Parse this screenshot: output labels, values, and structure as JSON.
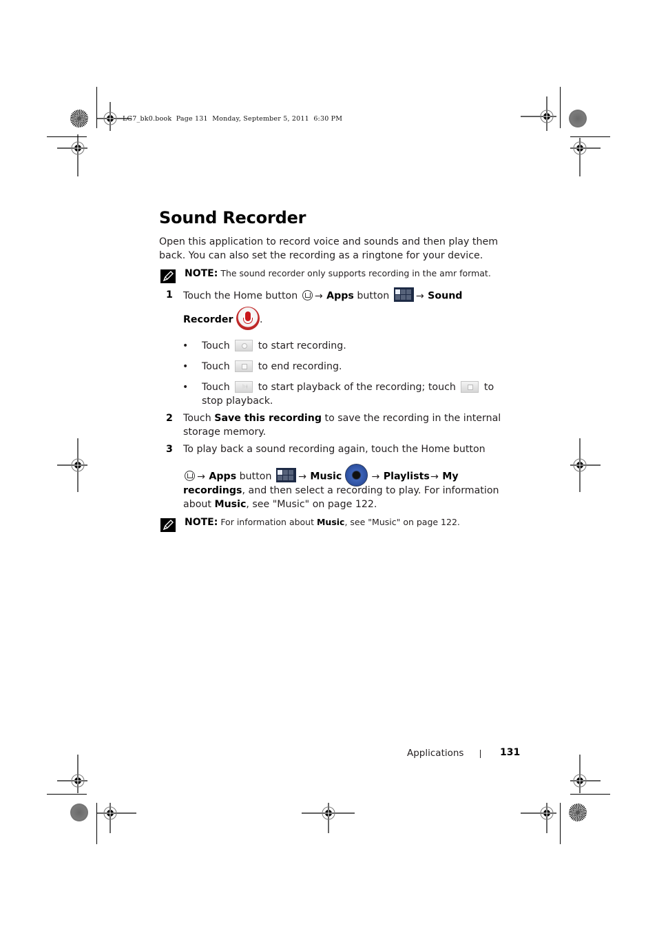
{
  "slug": "LG7_bk0.book  Page 131  Monday, September 5, 2011  6:30 PM",
  "title": "Sound Recorder",
  "intro": "Open this application to record voice and sounds and then play them back. You can also set the recording as a ringtone for your device.",
  "note1": {
    "label": "NOTE:",
    "text": " The sound recorder only supports recording in the amr format.",
    "icon": "pencil-note-icon"
  },
  "steps": [
    {
      "number": "1",
      "parts": {
        "t1": "Touch the Home button ",
        "arrow1": "→ ",
        "apps": "Apps",
        "t2": " button ",
        "arrow2": "→ ",
        "sound": "Sound",
        "recorder": "Recorder",
        "end": "."
      },
      "icons": [
        "home-icon",
        "apps-grid-icon",
        "microphone-icon"
      ],
      "bullets": [
        {
          "pre": "Touch ",
          "icon": "record-button-icon",
          "post": " to start recording."
        },
        {
          "pre": "Touch ",
          "icon": "stop-button-icon",
          "post": " to end recording."
        },
        {
          "pre": "Touch ",
          "icon": "play-button-icon",
          "mid": " to start playback of the recording; touch ",
          "icon2": "stop-button-icon",
          "post": " to stop playback."
        }
      ]
    },
    {
      "number": "2",
      "parts": {
        "t1": "Touch ",
        "bold": "Save this recording",
        "t2": " to save the recording in the internal storage memory."
      }
    },
    {
      "number": "3",
      "parts": {
        "t1": "To play back a sound recording again, touch the Home button",
        "arrow1": "→ ",
        "apps": "Apps",
        "t2": " button ",
        "arrow2": "→  ",
        "music": "Music",
        "arrow3": " → ",
        "playlists": "Playlists",
        "arrow4": "→ ",
        "my": "My",
        "recordings": "recordings",
        "t3": ", and then select a recording to play. For information about ",
        "music2": "Music",
        "t4": ", see \"Music\" on page 122."
      },
      "icons": [
        "home-icon",
        "apps-grid-icon",
        "music-speaker-icon"
      ]
    }
  ],
  "note2": {
    "label": "NOTE:",
    "pre": " For information about ",
    "bold": "Music",
    "post": ", see \"Music\" on page 122.",
    "icon": "pencil-note-icon"
  },
  "footer": {
    "section": "Applications",
    "page": "131"
  }
}
